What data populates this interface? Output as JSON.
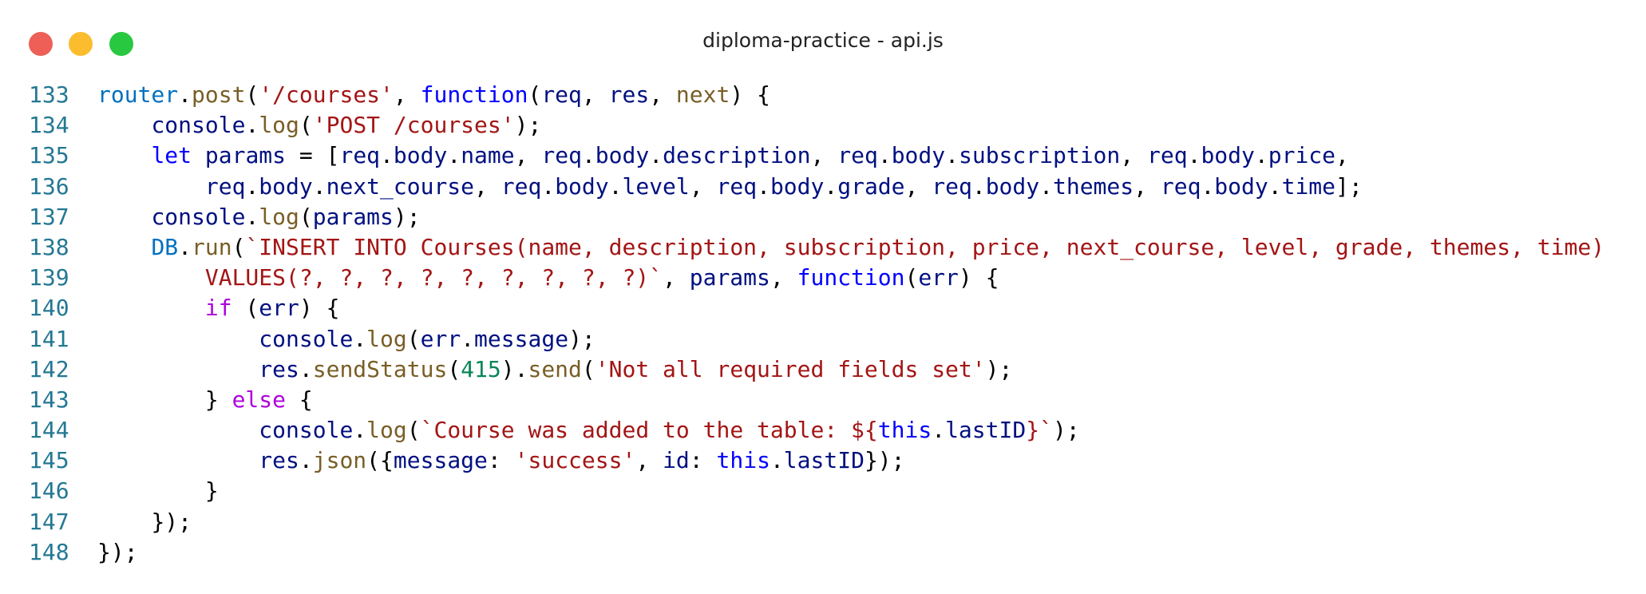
{
  "window": {
    "title": "diploma-practice - api.js",
    "controls": [
      {
        "name": "close",
        "color": "#ed5f57"
      },
      {
        "name": "minimize",
        "color": "#fbbc2e"
      },
      {
        "name": "maximize",
        "color": "#28c840"
      }
    ]
  },
  "colors": {
    "line_number": "#237893",
    "plain": "#000000",
    "variable": "#001080",
    "function_call": "#795e26",
    "string": "#a31515",
    "keyword_storage": "#0000ff",
    "keyword_control": "#af00db",
    "number": "#098658",
    "object_blue": "#0070c1"
  },
  "editor": {
    "lines": [
      {
        "n": "133",
        "tokens": [
          {
            "t": "router",
            "c": "object_blue"
          },
          {
            "t": ".",
            "c": "plain"
          },
          {
            "t": "post",
            "c": "function_call"
          },
          {
            "t": "(",
            "c": "plain"
          },
          {
            "t": "'/courses'",
            "c": "string"
          },
          {
            "t": ", ",
            "c": "plain"
          },
          {
            "t": "function",
            "c": "keyword_storage"
          },
          {
            "t": "(",
            "c": "plain"
          },
          {
            "t": "req",
            "c": "variable"
          },
          {
            "t": ", ",
            "c": "plain"
          },
          {
            "t": "res",
            "c": "variable"
          },
          {
            "t": ", ",
            "c": "plain"
          },
          {
            "t": "next",
            "c": "function_call"
          },
          {
            "t": ") {",
            "c": "plain"
          }
        ]
      },
      {
        "n": "134",
        "tokens": [
          {
            "t": "    ",
            "c": "plain"
          },
          {
            "t": "console",
            "c": "variable"
          },
          {
            "t": ".",
            "c": "plain"
          },
          {
            "t": "log",
            "c": "function_call"
          },
          {
            "t": "(",
            "c": "plain"
          },
          {
            "t": "'POST /courses'",
            "c": "string"
          },
          {
            "t": ");",
            "c": "plain"
          }
        ]
      },
      {
        "n": "135",
        "tokens": [
          {
            "t": "    ",
            "c": "plain"
          },
          {
            "t": "let",
            "c": "keyword_storage"
          },
          {
            "t": " ",
            "c": "plain"
          },
          {
            "t": "params",
            "c": "variable"
          },
          {
            "t": " = [",
            "c": "plain"
          },
          {
            "t": "req",
            "c": "variable"
          },
          {
            "t": ".",
            "c": "plain"
          },
          {
            "t": "body",
            "c": "variable"
          },
          {
            "t": ".",
            "c": "plain"
          },
          {
            "t": "name",
            "c": "variable"
          },
          {
            "t": ", ",
            "c": "plain"
          },
          {
            "t": "req",
            "c": "variable"
          },
          {
            "t": ".",
            "c": "plain"
          },
          {
            "t": "body",
            "c": "variable"
          },
          {
            "t": ".",
            "c": "plain"
          },
          {
            "t": "description",
            "c": "variable"
          },
          {
            "t": ", ",
            "c": "plain"
          },
          {
            "t": "req",
            "c": "variable"
          },
          {
            "t": ".",
            "c": "plain"
          },
          {
            "t": "body",
            "c": "variable"
          },
          {
            "t": ".",
            "c": "plain"
          },
          {
            "t": "subscription",
            "c": "variable"
          },
          {
            "t": ", ",
            "c": "plain"
          },
          {
            "t": "req",
            "c": "variable"
          },
          {
            "t": ".",
            "c": "plain"
          },
          {
            "t": "body",
            "c": "variable"
          },
          {
            "t": ".",
            "c": "plain"
          },
          {
            "t": "price",
            "c": "variable"
          },
          {
            "t": ",",
            "c": "plain"
          }
        ]
      },
      {
        "n": "136",
        "tokens": [
          {
            "t": "        ",
            "c": "plain"
          },
          {
            "t": "req",
            "c": "variable"
          },
          {
            "t": ".",
            "c": "plain"
          },
          {
            "t": "body",
            "c": "variable"
          },
          {
            "t": ".",
            "c": "plain"
          },
          {
            "t": "next_course",
            "c": "variable"
          },
          {
            "t": ", ",
            "c": "plain"
          },
          {
            "t": "req",
            "c": "variable"
          },
          {
            "t": ".",
            "c": "plain"
          },
          {
            "t": "body",
            "c": "variable"
          },
          {
            "t": ".",
            "c": "plain"
          },
          {
            "t": "level",
            "c": "variable"
          },
          {
            "t": ", ",
            "c": "plain"
          },
          {
            "t": "req",
            "c": "variable"
          },
          {
            "t": ".",
            "c": "plain"
          },
          {
            "t": "body",
            "c": "variable"
          },
          {
            "t": ".",
            "c": "plain"
          },
          {
            "t": "grade",
            "c": "variable"
          },
          {
            "t": ", ",
            "c": "plain"
          },
          {
            "t": "req",
            "c": "variable"
          },
          {
            "t": ".",
            "c": "plain"
          },
          {
            "t": "body",
            "c": "variable"
          },
          {
            "t": ".",
            "c": "plain"
          },
          {
            "t": "themes",
            "c": "variable"
          },
          {
            "t": ", ",
            "c": "plain"
          },
          {
            "t": "req",
            "c": "variable"
          },
          {
            "t": ".",
            "c": "plain"
          },
          {
            "t": "body",
            "c": "variable"
          },
          {
            "t": ".",
            "c": "plain"
          },
          {
            "t": "time",
            "c": "variable"
          },
          {
            "t": "];",
            "c": "plain"
          }
        ]
      },
      {
        "n": "137",
        "tokens": [
          {
            "t": "    ",
            "c": "plain"
          },
          {
            "t": "console",
            "c": "variable"
          },
          {
            "t": ".",
            "c": "plain"
          },
          {
            "t": "log",
            "c": "function_call"
          },
          {
            "t": "(",
            "c": "plain"
          },
          {
            "t": "params",
            "c": "variable"
          },
          {
            "t": ");",
            "c": "plain"
          }
        ]
      },
      {
        "n": "138",
        "tokens": [
          {
            "t": "    ",
            "c": "plain"
          },
          {
            "t": "DB",
            "c": "object_blue"
          },
          {
            "t": ".",
            "c": "plain"
          },
          {
            "t": "run",
            "c": "function_call"
          },
          {
            "t": "(",
            "c": "plain"
          },
          {
            "t": "`INSERT INTO Courses(name, description, subscription, price, next_course, level, grade, themes, time)",
            "c": "string"
          }
        ]
      },
      {
        "n": "139",
        "tokens": [
          {
            "t": "        ",
            "c": "plain"
          },
          {
            "t": "VALUES(?, ?, ?, ?, ?, ?, ?, ?, ?)`",
            "c": "string"
          },
          {
            "t": ", ",
            "c": "plain"
          },
          {
            "t": "params",
            "c": "variable"
          },
          {
            "t": ", ",
            "c": "plain"
          },
          {
            "t": "function",
            "c": "keyword_storage"
          },
          {
            "t": "(",
            "c": "plain"
          },
          {
            "t": "err",
            "c": "variable"
          },
          {
            "t": ") {",
            "c": "plain"
          }
        ]
      },
      {
        "n": "140",
        "tokens": [
          {
            "t": "        ",
            "c": "plain"
          },
          {
            "t": "if",
            "c": "keyword_control"
          },
          {
            "t": " (",
            "c": "plain"
          },
          {
            "t": "err",
            "c": "variable"
          },
          {
            "t": ") {",
            "c": "plain"
          }
        ]
      },
      {
        "n": "141",
        "tokens": [
          {
            "t": "            ",
            "c": "plain"
          },
          {
            "t": "console",
            "c": "variable"
          },
          {
            "t": ".",
            "c": "plain"
          },
          {
            "t": "log",
            "c": "function_call"
          },
          {
            "t": "(",
            "c": "plain"
          },
          {
            "t": "err",
            "c": "variable"
          },
          {
            "t": ".",
            "c": "plain"
          },
          {
            "t": "message",
            "c": "variable"
          },
          {
            "t": ");",
            "c": "plain"
          }
        ]
      },
      {
        "n": "142",
        "tokens": [
          {
            "t": "            ",
            "c": "plain"
          },
          {
            "t": "res",
            "c": "variable"
          },
          {
            "t": ".",
            "c": "plain"
          },
          {
            "t": "sendStatus",
            "c": "function_call"
          },
          {
            "t": "(",
            "c": "plain"
          },
          {
            "t": "415",
            "c": "number"
          },
          {
            "t": ").",
            "c": "plain"
          },
          {
            "t": "send",
            "c": "function_call"
          },
          {
            "t": "(",
            "c": "plain"
          },
          {
            "t": "'Not all required fields set'",
            "c": "string"
          },
          {
            "t": ");",
            "c": "plain"
          }
        ]
      },
      {
        "n": "143",
        "tokens": [
          {
            "t": "        ",
            "c": "plain"
          },
          {
            "t": "} ",
            "c": "plain"
          },
          {
            "t": "else",
            "c": "keyword_control"
          },
          {
            "t": " {",
            "c": "plain"
          }
        ]
      },
      {
        "n": "144",
        "tokens": [
          {
            "t": "            ",
            "c": "plain"
          },
          {
            "t": "console",
            "c": "variable"
          },
          {
            "t": ".",
            "c": "plain"
          },
          {
            "t": "log",
            "c": "function_call"
          },
          {
            "t": "(",
            "c": "plain"
          },
          {
            "t": "`Course was added to the table: ",
            "c": "string"
          },
          {
            "t": "${",
            "c": "string"
          },
          {
            "t": "this",
            "c": "keyword_storage"
          },
          {
            "t": ".",
            "c": "plain"
          },
          {
            "t": "lastID",
            "c": "variable"
          },
          {
            "t": "}`",
            "c": "string"
          },
          {
            "t": ");",
            "c": "plain"
          }
        ]
      },
      {
        "n": "145",
        "tokens": [
          {
            "t": "            ",
            "c": "plain"
          },
          {
            "t": "res",
            "c": "variable"
          },
          {
            "t": ".",
            "c": "plain"
          },
          {
            "t": "json",
            "c": "function_call"
          },
          {
            "t": "({",
            "c": "plain"
          },
          {
            "t": "message",
            "c": "variable"
          },
          {
            "t": ": ",
            "c": "plain"
          },
          {
            "t": "'success'",
            "c": "string"
          },
          {
            "t": ", ",
            "c": "plain"
          },
          {
            "t": "id",
            "c": "variable"
          },
          {
            "t": ": ",
            "c": "plain"
          },
          {
            "t": "this",
            "c": "keyword_storage"
          },
          {
            "t": ".",
            "c": "plain"
          },
          {
            "t": "lastID",
            "c": "variable"
          },
          {
            "t": "});",
            "c": "plain"
          }
        ]
      },
      {
        "n": "146",
        "tokens": [
          {
            "t": "        ",
            "c": "plain"
          },
          {
            "t": "}",
            "c": "plain"
          }
        ]
      },
      {
        "n": "147",
        "tokens": [
          {
            "t": "    ",
            "c": "plain"
          },
          {
            "t": "});",
            "c": "plain"
          }
        ]
      },
      {
        "n": "148",
        "tokens": [
          {
            "t": "});",
            "c": "plain"
          }
        ]
      }
    ]
  }
}
